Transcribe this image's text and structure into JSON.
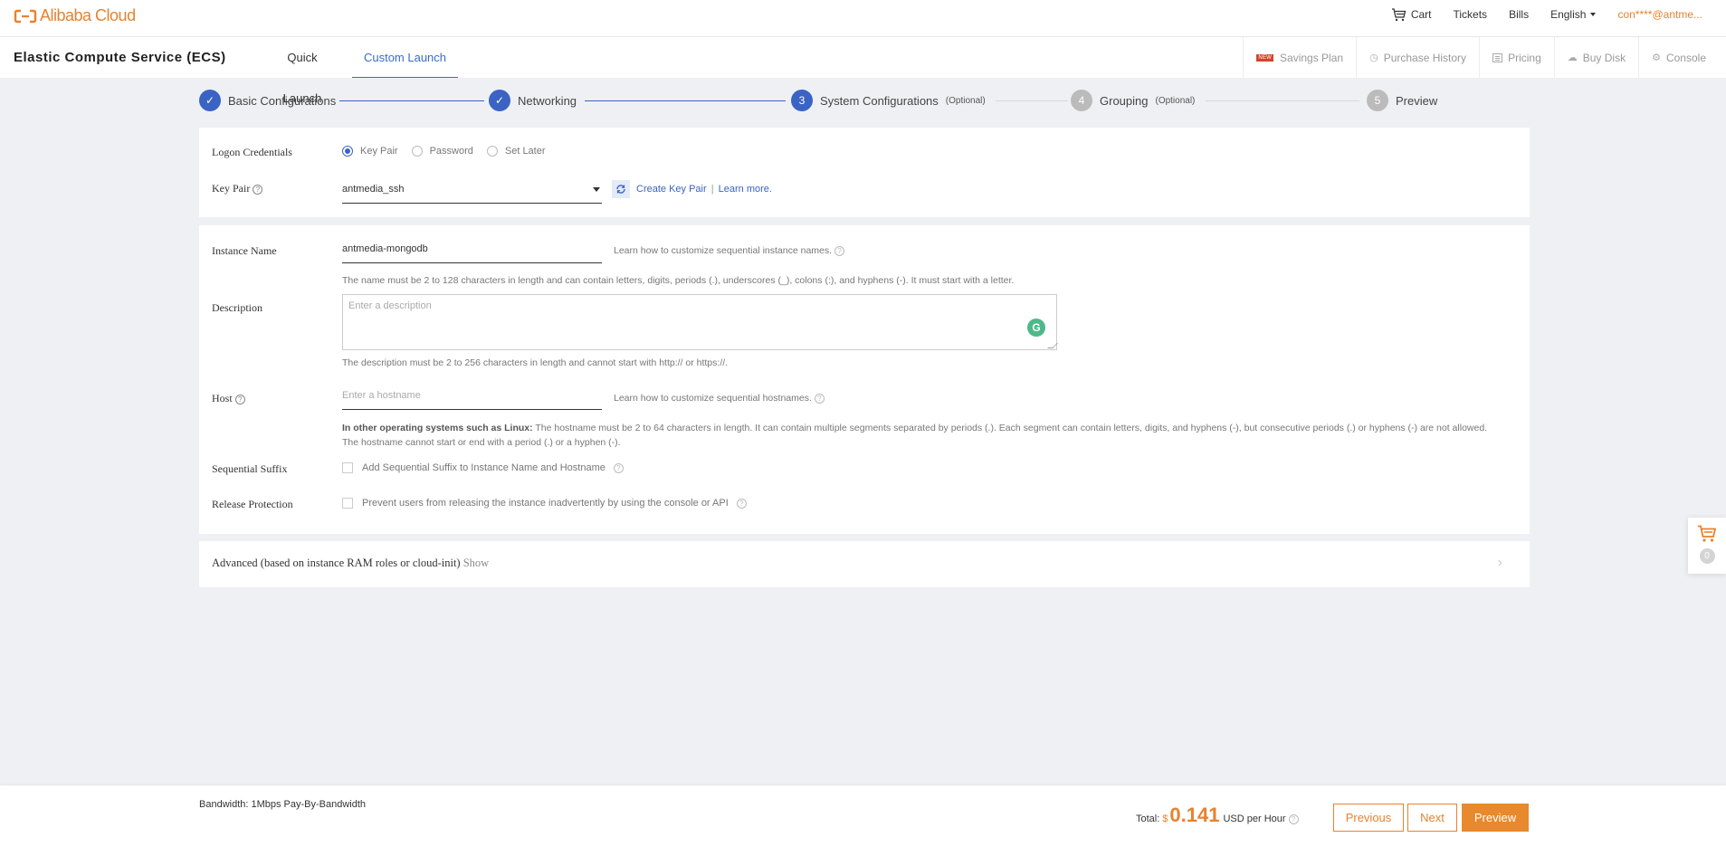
{
  "topbar": {
    "logo_text": "Alibaba Cloud",
    "cart": "Cart",
    "tickets": "Tickets",
    "bills": "Bills",
    "language": "English",
    "user": "con****@antme..."
  },
  "product": {
    "title": "Elastic Compute Service (ECS)",
    "tabs": [
      {
        "label": "Quick Launch",
        "active": false
      },
      {
        "label": "Custom Launch",
        "active": true
      }
    ],
    "links": [
      {
        "label": "Savings Plan",
        "badge": "NEW",
        "icon": "new-badge"
      },
      {
        "label": "Purchase History",
        "icon": "clock-icon"
      },
      {
        "label": "Pricing",
        "icon": "list-icon"
      },
      {
        "label": "Buy Disk",
        "icon": "cloud-disk-icon"
      },
      {
        "label": "Console",
        "icon": "gear-icon"
      }
    ]
  },
  "steps": [
    {
      "number": "1",
      "label": "Basic Configurations",
      "optional": "",
      "status": "done"
    },
    {
      "number": "2",
      "label": "Networking",
      "optional": "",
      "status": "done"
    },
    {
      "number": "3",
      "label": "System Configurations",
      "optional": "(Optional)",
      "status": "current"
    },
    {
      "number": "4",
      "label": "Grouping",
      "optional": "(Optional)",
      "status": "pending"
    },
    {
      "number": "5",
      "label": "Preview",
      "optional": "",
      "status": "pending"
    }
  ],
  "logon": {
    "label": "Logon Credentials",
    "options": [
      {
        "label": "Key Pair",
        "selected": true
      },
      {
        "label": "Password",
        "selected": false
      },
      {
        "label": "Set Later",
        "selected": false
      }
    ],
    "key_pair_label": "Key Pair",
    "key_pair_value": "antmedia_ssh",
    "create_link": "Create Key Pair",
    "separator": "|",
    "learn_more": "Learn more."
  },
  "instance": {
    "name_label": "Instance Name",
    "name_value": "antmedia-mongodb",
    "name_help": "Learn how to customize sequential instance names.",
    "name_rule": "The name must be 2 to 128 characters in length and can contain letters, digits, periods (.), underscores (_), colons (:), and hyphens (-). It must start with a letter.",
    "desc_label": "Description",
    "desc_placeholder": "Enter a description",
    "desc_rule": "The description must be 2 to 256 characters in length and cannot start with http:// or https://.",
    "host_label": "Host",
    "host_placeholder": "Enter a hostname",
    "host_help": "Learn how to customize sequential hostnames.",
    "host_rule_bold": "In other operating systems such as Linux:",
    "host_rule_1": " The hostname must be 2 to 64 characters in length. It can contain multiple segments separated by periods (.). Each segment can contain letters, digits, and hyphens (-), but consecutive periods (.) or hyphens (-) are not allowed.",
    "host_rule_2": "The hostname cannot start or end with a period (.) or a hyphen (-).",
    "suffix_label": "Sequential Suffix",
    "suffix_text": "Add Sequential Suffix to Instance Name and Hostname",
    "suffix_checked": false,
    "release_label": "Release Protection",
    "release_text": "Prevent users from releasing the instance inadvertently by using the console or API",
    "release_checked": false
  },
  "advanced": {
    "label": "Advanced (based on instance RAM roles or cloud-init)",
    "toggle": "Show"
  },
  "float_cart": {
    "count": "0"
  },
  "footer": {
    "bandwidth": "Bandwidth: 1Mbps Pay-By-Bandwidth",
    "total_label": "Total:",
    "currency": "$",
    "amount": "0.141",
    "unit": "USD per Hour",
    "previous": "Previous",
    "next": "Next",
    "preview": "Preview"
  },
  "colors": {
    "brand_orange": "#e8822d",
    "accent_blue": "#3a63c4",
    "grammarly_green": "#4fb88b"
  }
}
